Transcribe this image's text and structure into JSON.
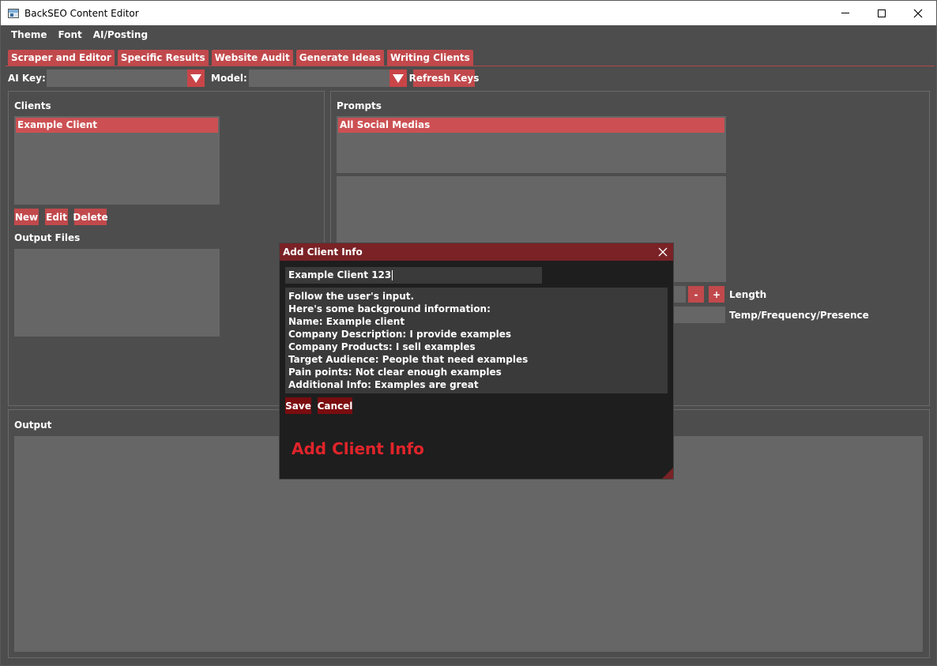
{
  "window": {
    "title": "BackSEO Content Editor",
    "controls": {
      "minimize": "—",
      "maximize": "☐",
      "close": "✕"
    }
  },
  "menu": [
    "Theme",
    "Font",
    "AI/Posting"
  ],
  "tabs": [
    "Scraper and Editor",
    "Specific Results",
    "Website Audit",
    "Generate Ideas",
    "Writing Clients"
  ],
  "ai": {
    "key_label": "AI Key:",
    "key_value": "",
    "model_label": "Model:",
    "model_value": "",
    "refresh_label": "Refresh Keys"
  },
  "clients": {
    "title": "Clients",
    "items": [
      "Example Client"
    ],
    "buttons": {
      "new": "New",
      "edit": "Edit",
      "delete": "Delete"
    },
    "output_files_title": "Output Files"
  },
  "prompts": {
    "title": "Prompts",
    "items": [
      "All Social Medias"
    ],
    "length_label": "Length",
    "minus_label": "-",
    "plus_label": "+",
    "temp_label": "Temp/Frequency/Presence"
  },
  "output": {
    "title": "Output"
  },
  "dialog": {
    "title": "Add Client Info",
    "close": "✕",
    "name_value": "Example Client 123",
    "lines": [
      "Follow the user's input.",
      "Here's some background information:",
      "Name: Example client",
      "Company Description: I provide examples",
      "Company Products: I sell examples",
      "Target Audience: People that need examples",
      "Pain points: Not clear enough examples",
      "Additional Info: Examples are great"
    ],
    "save_label": "Save",
    "cancel_label": "Cancel",
    "heading": "Add Client Info"
  },
  "colors": {
    "accent": "#c1494c",
    "selection": "#cc5053",
    "dialog_title": "#7a2226",
    "dialog_button": "#7a0d10",
    "heading_red": "#e0242a",
    "background": "#4d4d4d",
    "field": "#666666"
  }
}
